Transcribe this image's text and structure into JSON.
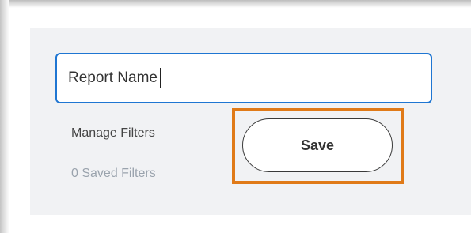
{
  "report": {
    "name_value": "Report Name"
  },
  "filters": {
    "manage_label": "Manage Filters",
    "saved_count_label": "0 Saved Filters"
  },
  "actions": {
    "save_label": "Save"
  },
  "colors": {
    "input_border": "#1f76d2",
    "highlight_border": "#e07a18",
    "panel_background": "#f1f2f4",
    "muted_text": "#9aa3ad"
  }
}
